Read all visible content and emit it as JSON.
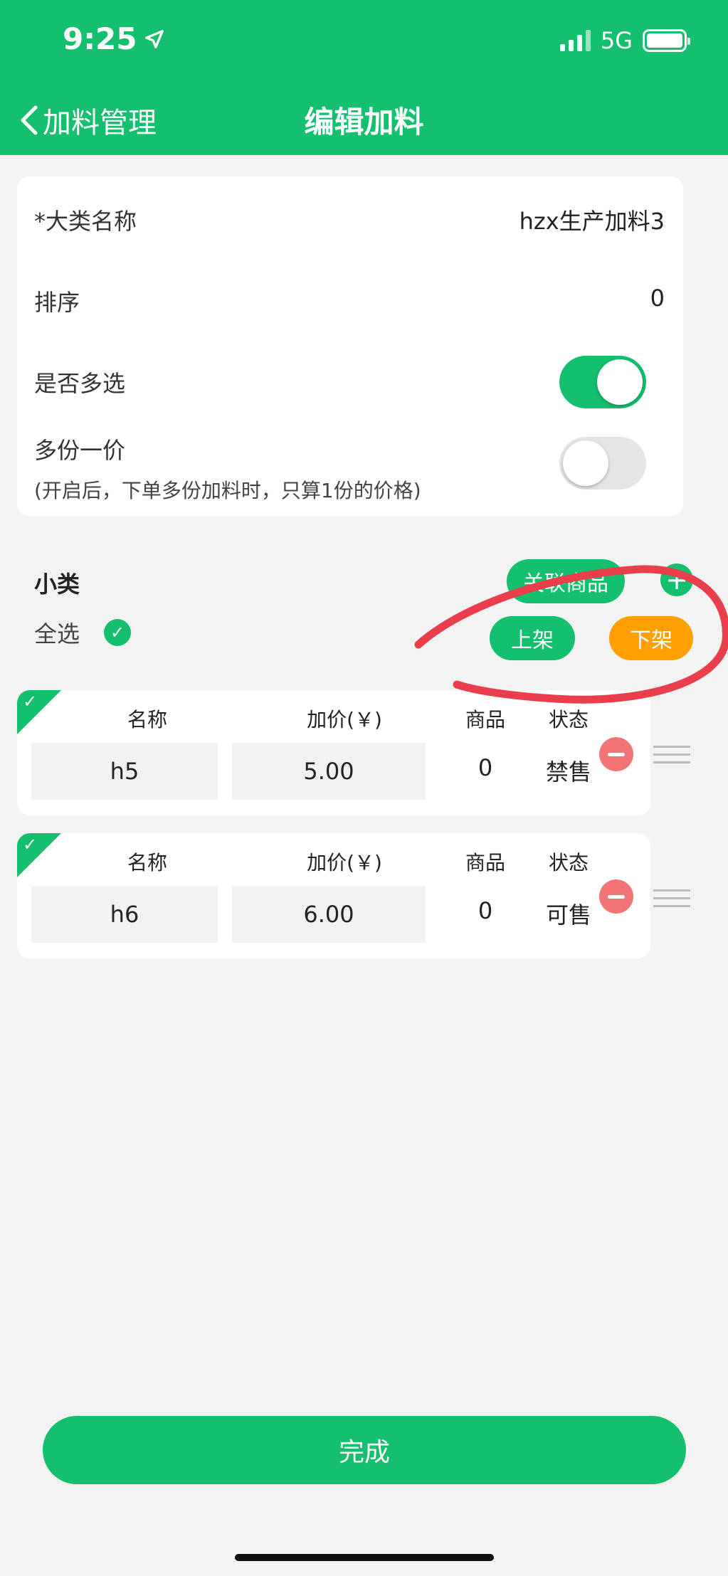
{
  "status_bar": {
    "time": "9:25",
    "network": "5G"
  },
  "nav": {
    "back_label": "加料管理",
    "title": "编辑加料"
  },
  "form": {
    "category_label": "*大类名称",
    "category_value": "hzx生产加料3",
    "sort_label": "排序",
    "sort_value": "0",
    "multi_select_label": "是否多选",
    "multi_select_on": true,
    "one_price_label": "多份一价",
    "one_price_hint": "(开启后，下单多份加料时，只算1份的价格)",
    "one_price_on": false
  },
  "subcategory": {
    "title": "小类",
    "select_all_label": "全选",
    "link_goods_label": "关联商品",
    "add_icon": "plus-icon",
    "on_shelf_label": "上架",
    "off_shelf_label": "下架"
  },
  "table_headers": {
    "name": "名称",
    "price": "加价(￥)",
    "goods": "商品",
    "status": "状态"
  },
  "items": [
    {
      "name": "h5",
      "price": "5.00",
      "goods": "0",
      "status": "禁售"
    },
    {
      "name": "h6",
      "price": "6.00",
      "goods": "0",
      "status": "可售"
    }
  ],
  "finish_label": "完成",
  "colors": {
    "primary": "#14bf6e",
    "orange": "#ff9f00",
    "danger": "#f27474",
    "annotation": "#ea3f4a"
  }
}
